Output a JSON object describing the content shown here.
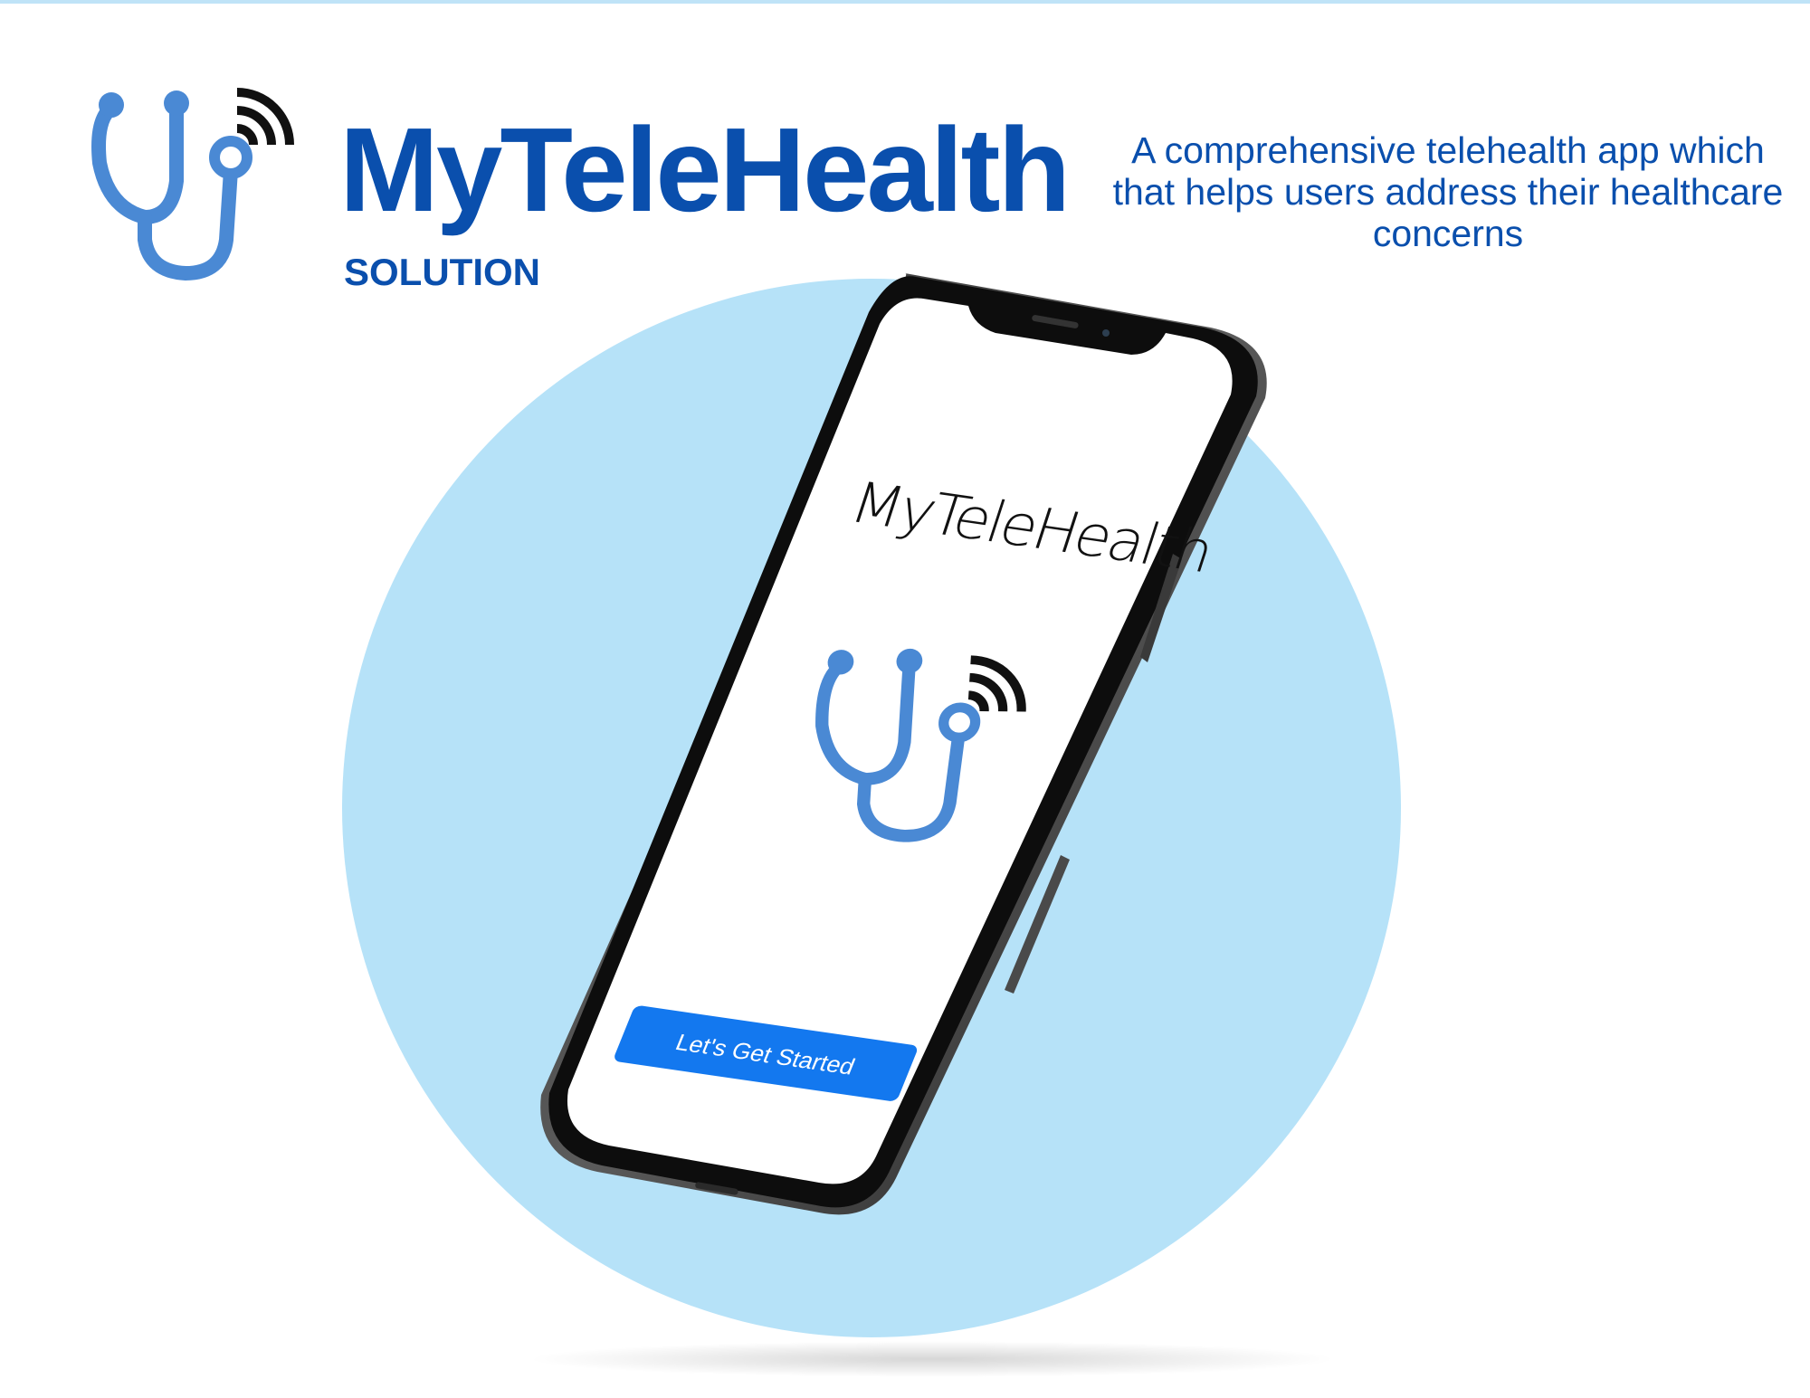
{
  "brand": {
    "title": "MyTeleHealth",
    "subtitle": "SOLUTION",
    "tagline": "A comprehensive telehealth app which that helps users address their healthcare concerns"
  },
  "icons": {
    "header_logo": "stethoscope-wifi-icon",
    "screen_logo": "stethoscope-wifi-icon"
  },
  "phone_screen": {
    "app_title": "MyTeleHealth",
    "cta_label": "Let's Get Started"
  },
  "colors": {
    "brand_blue": "#0a4fad",
    "logo_blue": "#4a89d4",
    "circle_bg": "#b6e2f8",
    "button_blue": "#1378ef"
  }
}
